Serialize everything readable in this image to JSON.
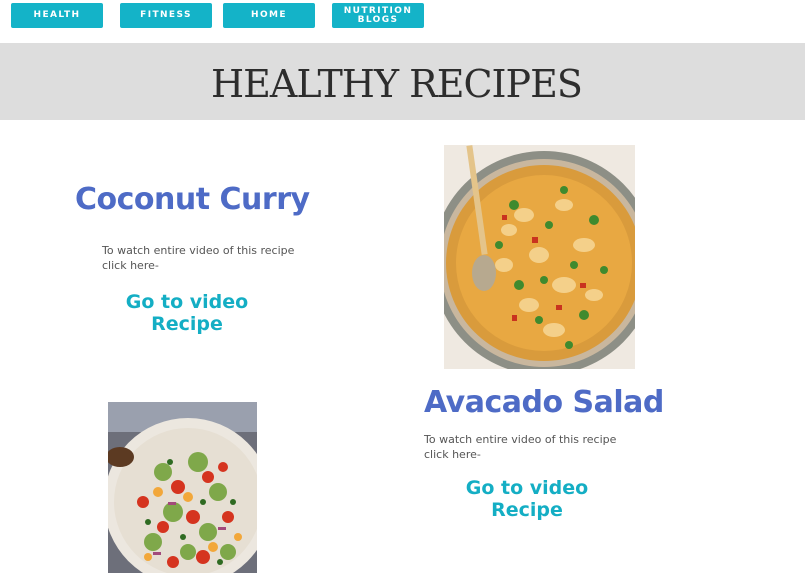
{
  "nav": {
    "items": [
      {
        "label": "HEALTH"
      },
      {
        "label": "FITNESS"
      },
      {
        "label": "HOME"
      },
      {
        "label_line1": "NUTRITION",
        "label_line2": "BLOGS"
      }
    ],
    "color": "#14b3c8"
  },
  "banner": {
    "title": "HEALTHY RECIPES",
    "background": "#dddddd"
  },
  "recipes": [
    {
      "title": "Coconut Curry",
      "description": "To watch entire video of this recipe click here-",
      "link_line1": "Go to video",
      "link_line2": "Recipe",
      "image": "coconut-curry-photo"
    },
    {
      "title": "Avacado Salad",
      "description": "To watch entire video of this recipe click here-",
      "link_line1": "Go to video",
      "link_line2": "Recipe",
      "image": "avocado-salad-photo"
    }
  ],
  "colors": {
    "title": "#4e6bc6",
    "link": "#14aec4"
  }
}
